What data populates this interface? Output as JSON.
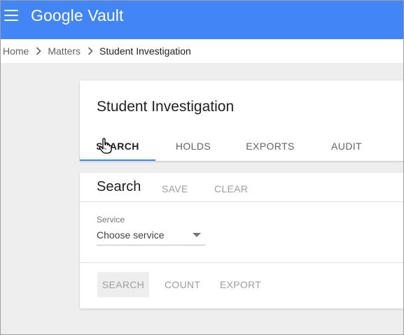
{
  "app": {
    "title": "Google Vault"
  },
  "breadcrumb": {
    "items": [
      "Home",
      "Matters"
    ],
    "current": "Student Investigation"
  },
  "matter": {
    "title": "Student Investigation",
    "tabs": [
      {
        "label": "SEARCH",
        "active": true
      },
      {
        "label": "HOLDS",
        "active": false
      },
      {
        "label": "EXPORTS",
        "active": false
      },
      {
        "label": "AUDIT",
        "active": false
      }
    ]
  },
  "search": {
    "title": "Search",
    "save_label": "SAVE",
    "clear_label": "CLEAR",
    "service_label": "Service",
    "service_value": "Choose service",
    "actions": {
      "search": "SEARCH",
      "count": "COUNT",
      "export": "EXPORT"
    }
  },
  "colors": {
    "appbar": "#4285f4",
    "tab_indicator": "#4285f4"
  },
  "icons": [
    "menu-icon",
    "chevron-right-icon",
    "dropdown-arrow-icon",
    "hand-cursor-icon"
  ]
}
